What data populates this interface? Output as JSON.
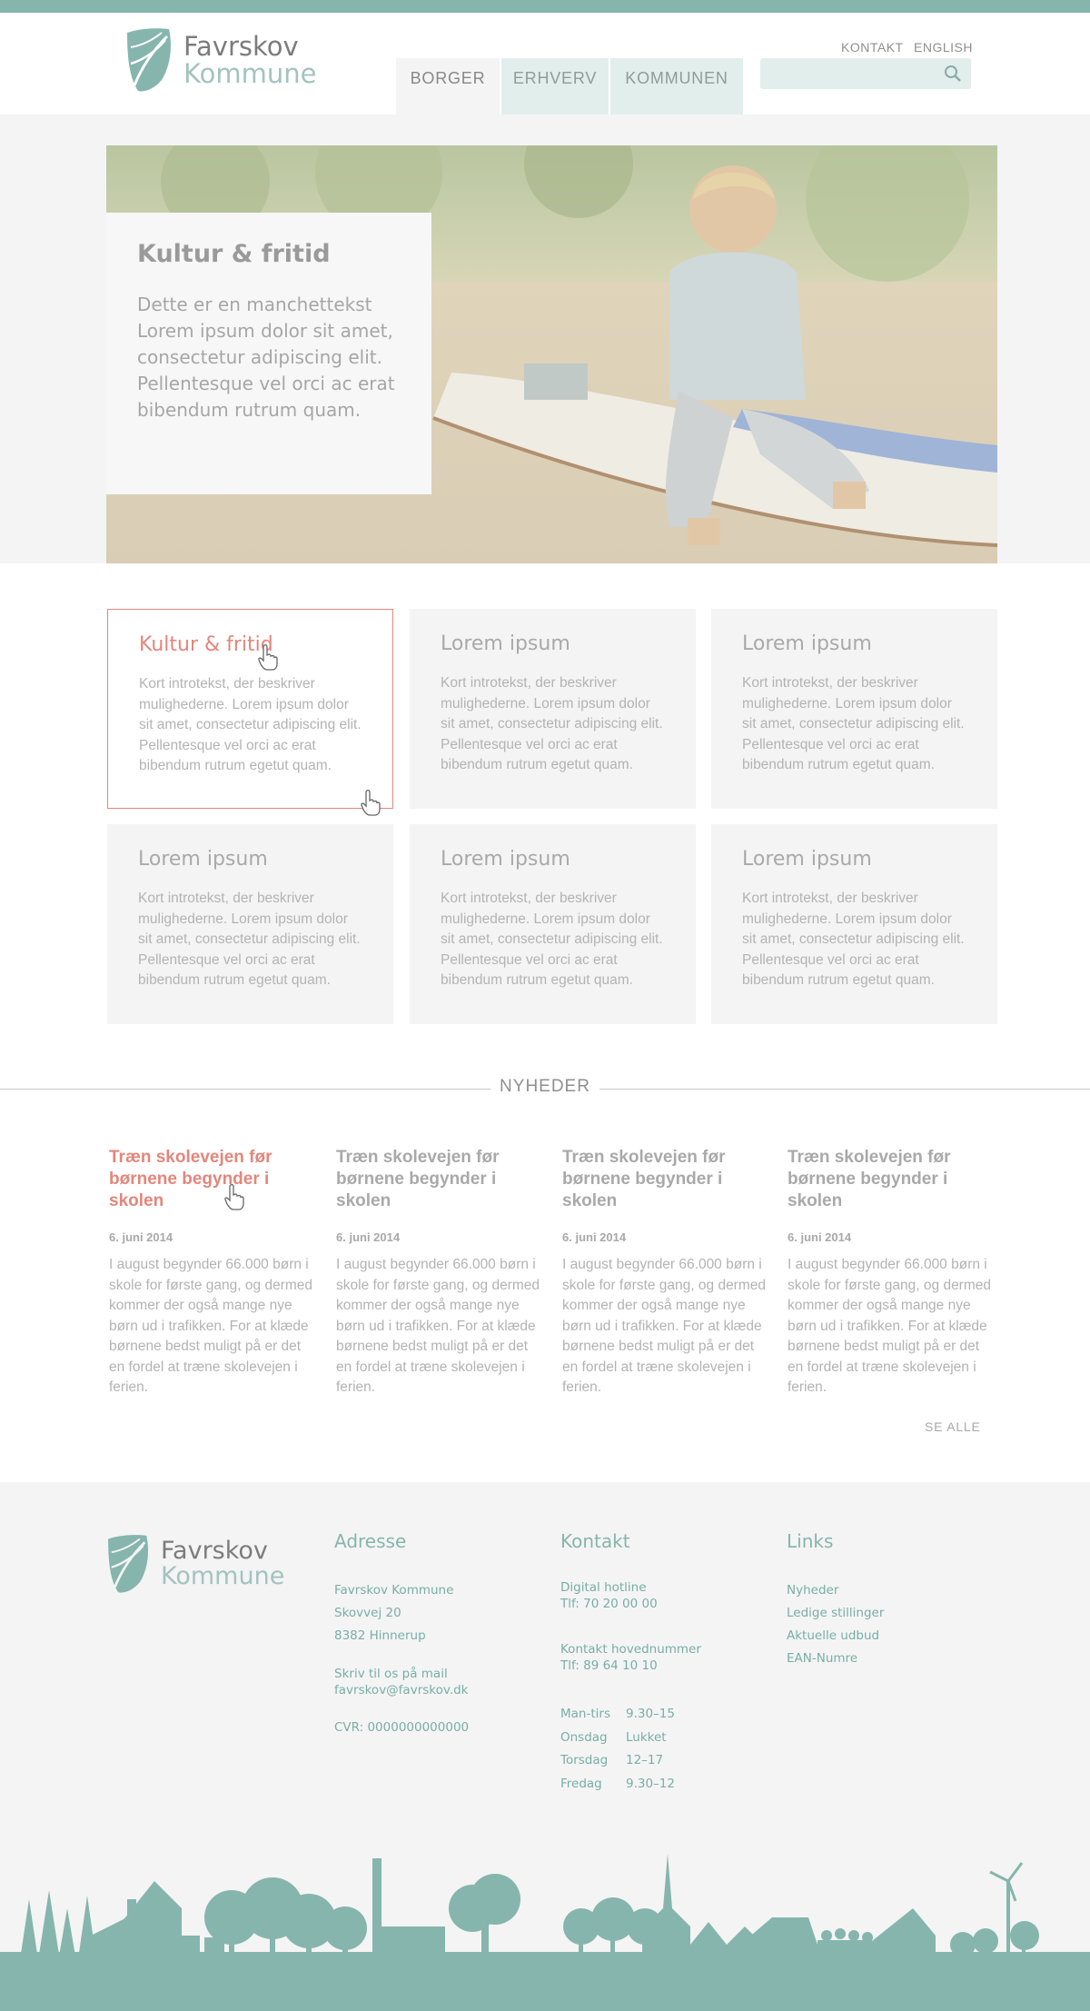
{
  "brand": {
    "name_line1": "Favrskov",
    "name_line2": "Kommune",
    "accent": "#86b5ad",
    "highlight": "#e4867c"
  },
  "utility_nav": {
    "contact": "KONTAKT",
    "english": "ENGLISH"
  },
  "main_nav": {
    "items": [
      {
        "label": "BORGER",
        "active": true
      },
      {
        "label": "ERHVERV",
        "active": false
      },
      {
        "label": "KOMMUNEN",
        "active": false
      }
    ]
  },
  "search": {
    "placeholder": "",
    "icon": "search-icon"
  },
  "hero": {
    "title": "Kultur & fritid",
    "text": "Dette er en manchettekst Lorem ipsum dolor sit amet, consectetur adipiscing elit. Pellentesque vel orci ac erat bibendum rutrum quam."
  },
  "cards": [
    {
      "title": "Kultur & fritid",
      "text": "Kort introtekst, der beskriver mulighederne. Lorem ipsum dolor sit amet, consectetur adipiscing elit. Pellentesque vel orci ac erat bibendum rutrum egetut quam."
    },
    {
      "title": "Lorem ipsum",
      "text": "Kort introtekst, der beskriver mulighederne. Lorem ipsum dolor sit amet, consectetur adipiscing elit. Pellentesque vel orci ac erat bibendum rutrum egetut quam."
    },
    {
      "title": "Lorem ipsum",
      "text": "Kort introtekst, der beskriver mulighederne. Lorem ipsum dolor sit amet, consectetur adipiscing elit. Pellentesque vel orci ac erat bibendum rutrum egetut quam."
    },
    {
      "title": "Lorem ipsum",
      "text": "Kort introtekst, der beskriver mulighederne. Lorem ipsum dolor sit amet, consectetur adipiscing elit. Pellentesque vel orci ac erat bibendum rutrum egetut quam."
    },
    {
      "title": "Lorem ipsum",
      "text": "Kort introtekst, der beskriver mulighederne. Lorem ipsum dolor sit amet, consectetur adipiscing elit. Pellentesque vel orci ac erat bibendum rutrum egetut quam."
    },
    {
      "title": "Lorem ipsum",
      "text": "Kort introtekst, der beskriver mulighederne. Lorem ipsum dolor sit amet, consectetur adipiscing elit. Pellentesque vel orci ac erat bibendum rutrum egetut quam."
    }
  ],
  "news": {
    "heading": "NYHEDER",
    "see_all": "SE ALLE",
    "items": [
      {
        "title": "Træn skolevejen før børnene begynder i skolen",
        "date": "6. juni 2014",
        "text": "I august begynder 66.000 børn i skole for første gang, og dermed kommer der også mange nye børn ud i trafikken. For at klæde børnene bedst muligt på er det en fordel at træne skolevejen i ferien."
      },
      {
        "title": "Træn skolevejen før børnene begynder i skolen",
        "date": "6. juni 2014",
        "text": "I august begynder 66.000 børn i skole for første gang, og dermed kommer der også mange nye børn ud i trafikken. For at klæde børnene bedst muligt på er det en fordel at træne skolevejen i ferien."
      },
      {
        "title": "Træn skolevejen før børnene begynder i skolen",
        "date": "6. juni 2014",
        "text": "I august begynder 66.000 børn i skole for første gang, og dermed kommer der også mange nye børn ud i trafikken. For at klæde børnene bedst muligt på er det en fordel at træne skolevejen i ferien."
      },
      {
        "title": "Træn skolevejen før børnene begynder i skolen",
        "date": "6. juni 2014",
        "text": "I august begynder 66.000 børn i skole for første gang, og dermed kommer der også mange nye børn ud i trafikken. For at klæde børnene bedst muligt på er det en fordel at træne skolevejen i ferien."
      }
    ]
  },
  "footer": {
    "address": {
      "heading": "Adresse",
      "name": "Favrskov Kommune",
      "street": "Skovvej 20",
      "city": "8382 Hinnerup",
      "mail_label": "Skriv til os på mail",
      "mail": "favrskov@favrskov.dk",
      "cvr": "CVR: 0000000000000"
    },
    "contact": {
      "heading": "Kontakt",
      "hotline_label": "Digital hotline",
      "hotline_phone": "Tlf: 70 20 00 00",
      "main_label": "Kontakt hovednummer",
      "main_phone": "Tlf: 89 64 10 10",
      "hours": [
        {
          "day": "Man-tirs",
          "time": "9.30–15"
        },
        {
          "day": "Onsdag",
          "time": "Lukket"
        },
        {
          "day": "Torsdag",
          "time": "12–17"
        },
        {
          "day": "Fredag",
          "time": "9.30–12"
        }
      ]
    },
    "links": {
      "heading": "Links",
      "items": [
        "Nyheder",
        "Ledige stillinger",
        "Aktuelle udbud",
        "EAN-Numre"
      ]
    }
  }
}
